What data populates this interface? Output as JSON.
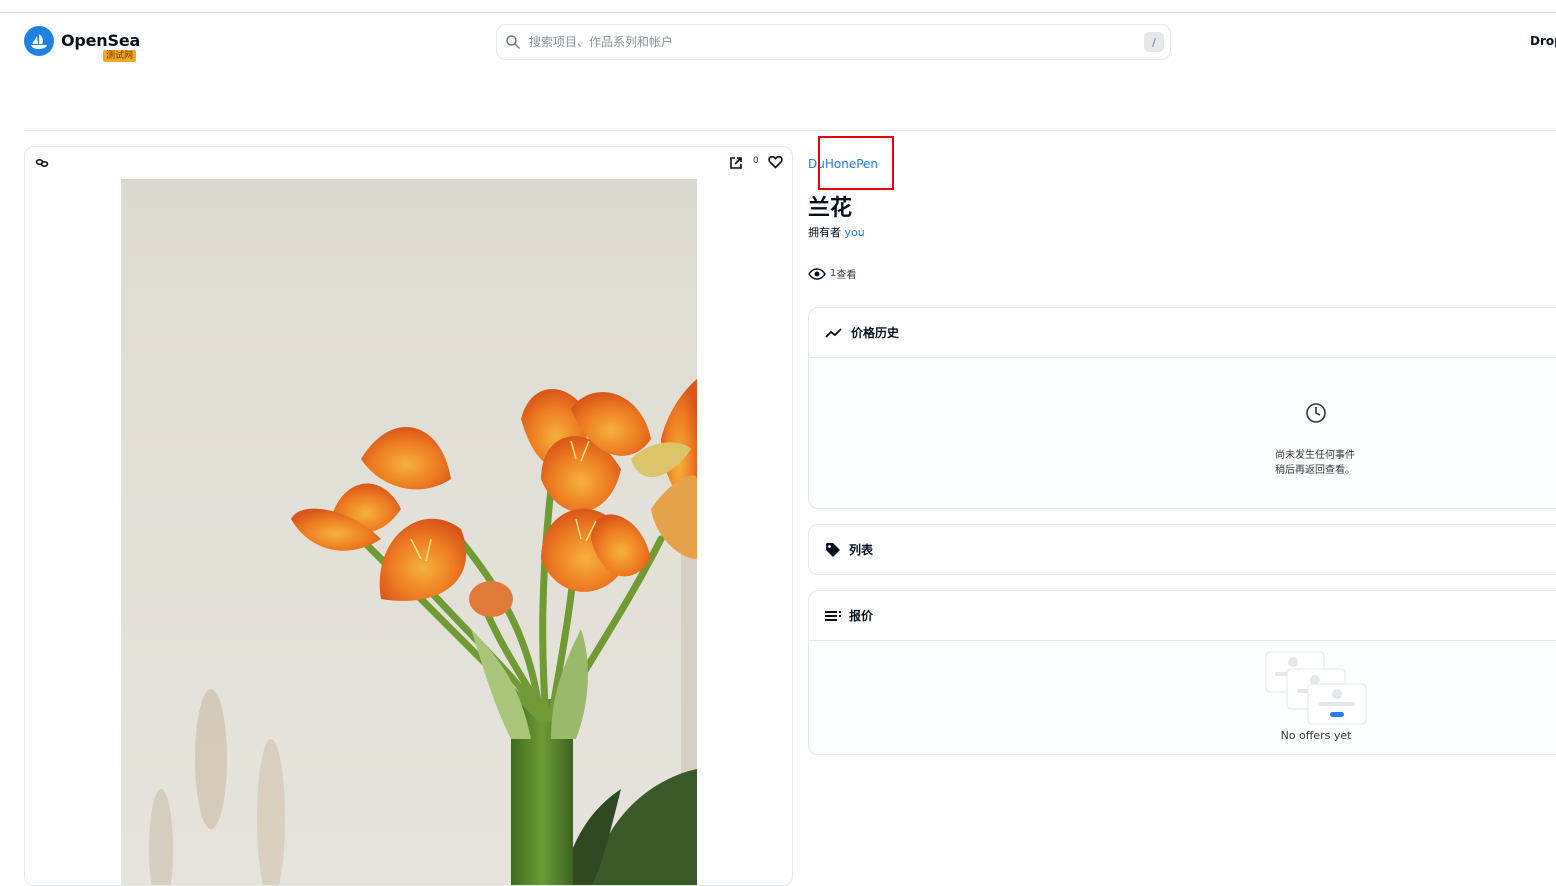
{
  "header": {
    "logo_name": "OpenSea",
    "testnet_badge": "测试网",
    "search_placeholder": "搜索项目、作品系列和帐户",
    "search_shortcut": "/",
    "nav_drops": "Drop"
  },
  "media": {
    "favorite_count": "0",
    "icons": [
      "chain-icon",
      "share-icon",
      "heart-icon"
    ]
  },
  "item": {
    "collection": "DuHonePen",
    "title": "兰花",
    "owned_by_label": "拥有者",
    "owner": "you",
    "views_count": "1",
    "views_label": "查看"
  },
  "panels": {
    "price_history": {
      "title": "价格历史",
      "empty_line1": "尚未发生任何事件",
      "empty_line2": "稍后再返回查看。"
    },
    "listings": {
      "title": "列表"
    },
    "offers": {
      "title": "报价",
      "empty": "No offers yet"
    }
  },
  "colors": {
    "accent": "#2081e2",
    "highlight": "#e8000b",
    "badge": "#f5a623"
  }
}
